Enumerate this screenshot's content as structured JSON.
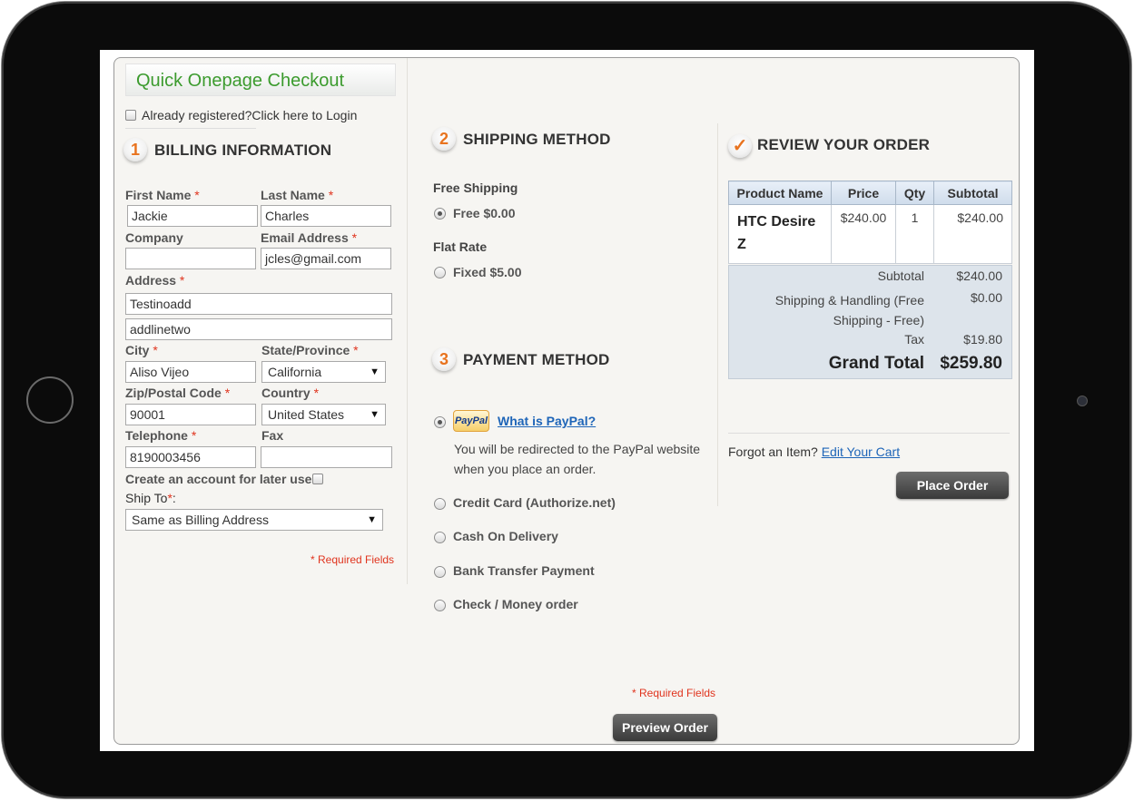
{
  "checkout": {
    "title": "Quick Onepage Checkout",
    "login_text": "Already registered?Click here to Login",
    "required_note": "* Required Fields",
    "preview_button": "Preview Order"
  },
  "billing": {
    "step": "1",
    "title": "BILLING INFORMATION",
    "first_name_label": "First Name",
    "first_name": "Jackie",
    "last_name_label": "Last Name",
    "last_name": "Charles",
    "company_label": "Company",
    "company": "",
    "email_label": "Email Address",
    "email": "jcles@gmail.com",
    "address_label": "Address",
    "address_line1": "Testinoadd",
    "address_line2": "addlinetwo",
    "city_label": "City",
    "city": "Aliso Vijeo",
    "state_label": "State/Province",
    "state": "California",
    "zip_label": "Zip/Postal Code",
    "zip": "90001",
    "country_label": "Country",
    "country": "United States",
    "telephone_label": "Telephone",
    "telephone": "8190003456",
    "fax_label": "Fax",
    "fax": "",
    "create_account_label": "Create an account for later use",
    "ship_to_label": "Ship To",
    "ship_to": "Same as Billing Address",
    "required_star": "*",
    "required_note": "* Required Fields"
  },
  "shipping": {
    "step": "2",
    "title": "SHIPPING METHOD",
    "groups": [
      {
        "name": "Free Shipping",
        "option": "Free $0.00",
        "selected": true
      },
      {
        "name": "Flat Rate",
        "option": "Fixed $5.00",
        "selected": false
      }
    ]
  },
  "payment": {
    "step": "3",
    "title": "PAYMENT METHOD",
    "paypal_logo": "PayPal",
    "paypal_link": "What is PayPal?",
    "paypal_desc_1": "You will be redirected to the PayPal website",
    "paypal_desc_2": "when you place an order.",
    "options": [
      "Credit Card (Authorize.net)",
      "Cash On Delivery",
      "Bank Transfer Payment",
      "Check / Money order"
    ]
  },
  "review": {
    "step": "✓",
    "title": "REVIEW YOUR ORDER",
    "headers": [
      "Product Name",
      "Price",
      "Qty",
      "Subtotal"
    ],
    "item": {
      "name_1": "HTC Desire",
      "name_2": "Z",
      "price": "$240.00",
      "qty": "1",
      "subtotal": "$240.00"
    },
    "subtotal_label": "Subtotal",
    "subtotal": "$240.00",
    "shipping_label_1": "Shipping & Handling (Free",
    "shipping_label_2": "Shipping - Free)",
    "shipping": "$0.00",
    "tax_label": "Tax",
    "tax": "$19.80",
    "grand_total_label": "Grand Total",
    "grand_total": "$259.80",
    "forgot_text": "Forgot an Item?",
    "edit_cart": "Edit Your Cart",
    "place_order": "Place Order"
  }
}
